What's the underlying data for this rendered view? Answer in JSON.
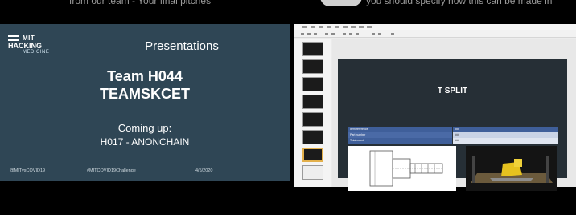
{
  "caption": {
    "left_text": "from our team - Your final pitches",
    "right_text": "you should specify how this can be made in"
  },
  "slide": {
    "logo": {
      "line1": "MIT",
      "line2": "HACKING",
      "line3": "MEDICINE"
    },
    "title": "Presentations",
    "team_id": "Team H044",
    "team_name": "TEAMSKCET",
    "coming_up_label": "Coming up:",
    "coming_up_team": "H017 - ANONCHAIN",
    "footer": {
      "handle": "@MITvsCOVID19",
      "hashtag": "#MITCOVID19Challenge",
      "date": "4/5/2020"
    }
  },
  "presentation_window": {
    "slide_title": "T SPLIT",
    "table_rows": [
      {
        "label": "Item reference",
        "value": "##"
      },
      {
        "label": "Part number",
        "value": "##"
      },
      {
        "label": "Total count",
        "value": "##"
      }
    ],
    "thumbnails": [
      "1",
      "2",
      "3",
      "4",
      "5",
      "6",
      "7",
      "8"
    ],
    "selected_thumbnail": 7,
    "colors": {
      "slide_bg": "#2f4655",
      "editor_slide_bg": "#262f36",
      "table_header": "#3f5f9a",
      "table_body": "#c9d3e6",
      "selection": "#e3b04b"
    }
  }
}
